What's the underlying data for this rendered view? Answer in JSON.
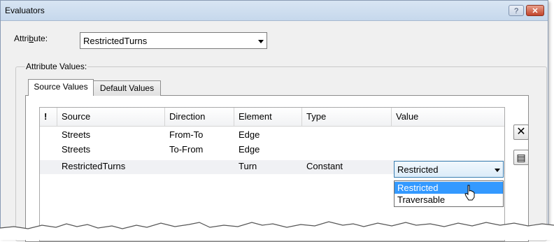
{
  "window": {
    "title": "Evaluators",
    "help_label": "?",
    "close_label": "✕"
  },
  "attribute": {
    "label_prefix": "Attri",
    "label_mnemonic": "b",
    "label_suffix": "ute:",
    "value": "RestrictedTurns"
  },
  "group": {
    "label": "Attribute Values:"
  },
  "tabs": [
    {
      "label": "Source Values",
      "active": true
    },
    {
      "label": "Default Values",
      "active": false
    }
  ],
  "grid": {
    "columns": [
      "!",
      "Source",
      "Direction",
      "Element",
      "Type",
      "Value"
    ],
    "rows": [
      {
        "source": "Streets",
        "direction": "From-To",
        "element": "Edge",
        "type": "",
        "value": ""
      },
      {
        "source": "Streets",
        "direction": "To-From",
        "element": "Edge",
        "type": "",
        "value": ""
      },
      {
        "source": "RestrictedTurns",
        "direction": "",
        "element": "Turn",
        "type": "Constant",
        "value": "Restricted"
      }
    ]
  },
  "value_dropdown": {
    "selected": "Restricted",
    "options": [
      "Restricted",
      "Traversable"
    ],
    "highlighted": "Restricted"
  },
  "side_buttons": [
    {
      "icon": "delete-x-icon",
      "glyph": "✕"
    },
    {
      "icon": "properties-icon",
      "glyph": "▤"
    }
  ],
  "colors": {
    "highlight": "#3399ff",
    "close_button": "#c2442b",
    "title_bar": "#c6d8ec"
  }
}
